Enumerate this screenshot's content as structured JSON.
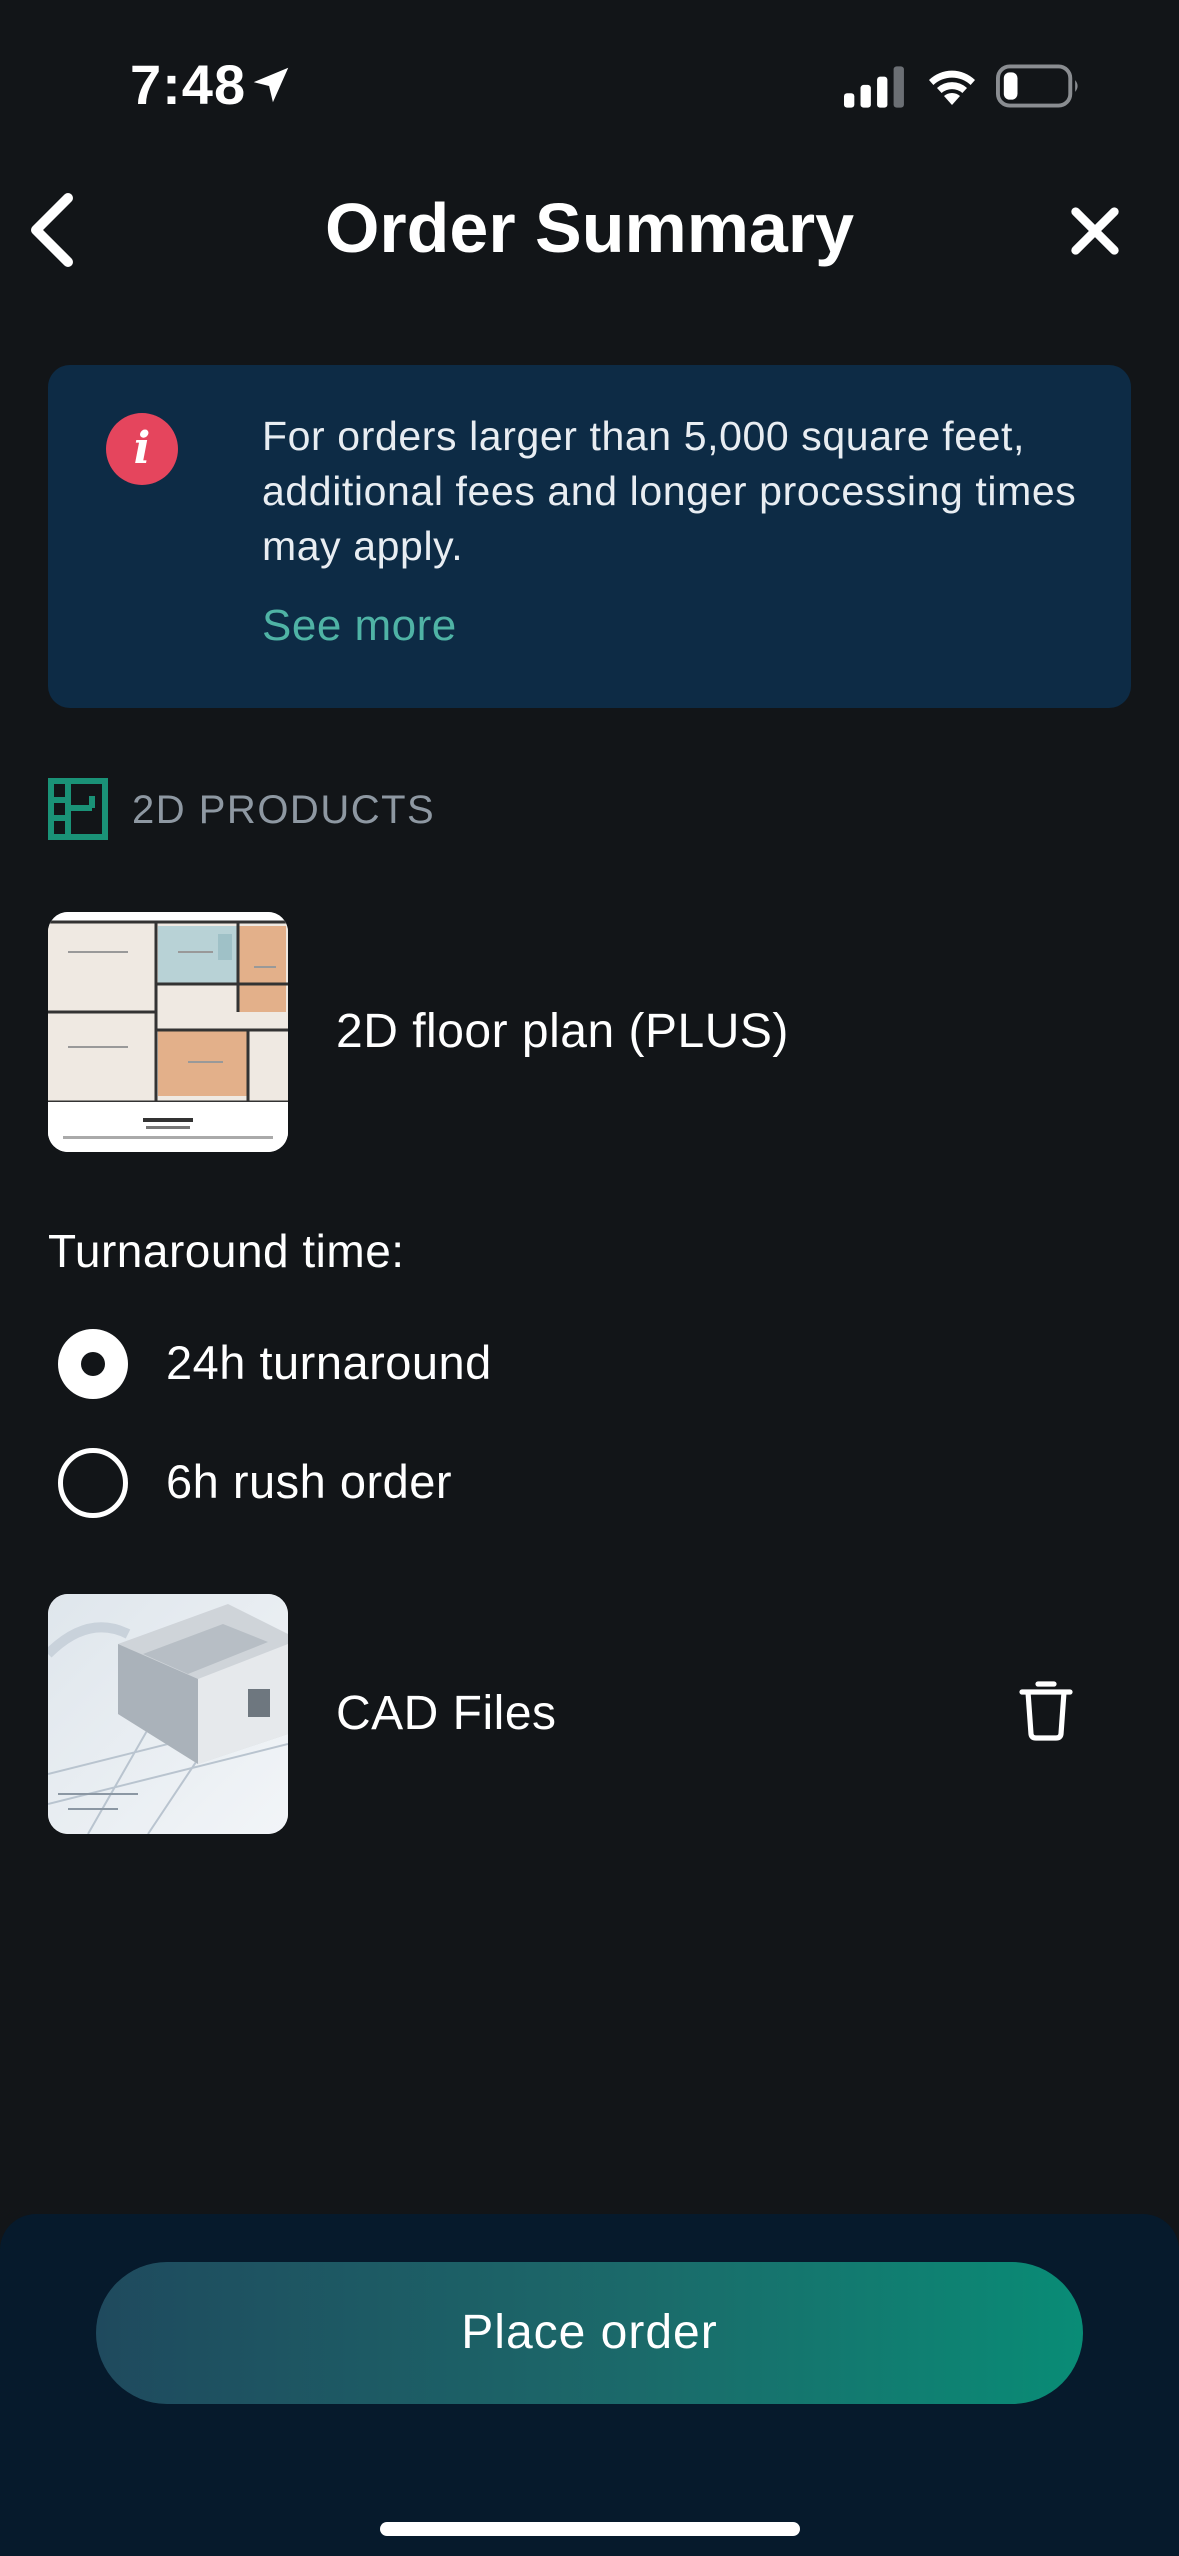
{
  "status_bar": {
    "time": "7:48",
    "location_icon": "location-arrow-icon",
    "signal_icon": "cellular-signal-icon",
    "wifi_icon": "wifi-icon",
    "battery_icon": "battery-low-icon"
  },
  "header": {
    "title": "Order Summary",
    "back_icon": "chevron-left-icon",
    "close_icon": "close-icon"
  },
  "info_banner": {
    "icon": "info-icon",
    "icon_glyph": "i",
    "message": "For orders larger than 5,000 square feet, additional fees and longer processing times may apply.",
    "link_label": "See more",
    "background_color": "#0d2b45",
    "icon_color": "#e5455d",
    "link_color": "#4fb3a5"
  },
  "section": {
    "icon": "floor-plan-icon",
    "label": "2D PRODUCTS",
    "icon_color": "#1a9277"
  },
  "products": [
    {
      "name": "2D floor plan (PLUS)",
      "thumbnail": "floor-plan-thumbnail"
    },
    {
      "name": "CAD Files",
      "thumbnail": "cad-model-thumbnail",
      "action_icon": "trash-icon"
    }
  ],
  "turnaround": {
    "label": "Turnaround time:",
    "options": [
      {
        "label": "24h turnaround",
        "selected": true
      },
      {
        "label": "6h rush order",
        "selected": false
      }
    ]
  },
  "footer": {
    "place_order_label": "Place order",
    "button_gradient": [
      "#1f4a5e",
      "#098c76"
    ]
  }
}
